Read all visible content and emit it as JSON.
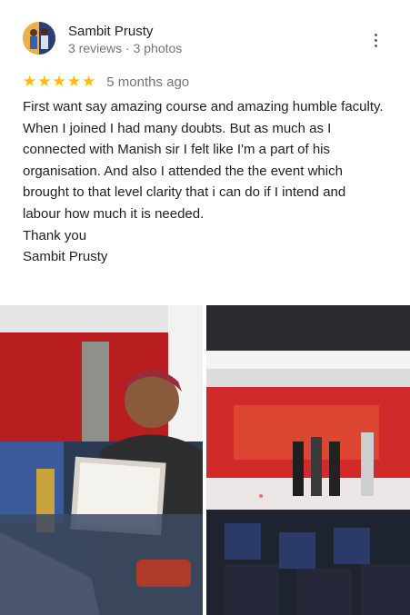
{
  "review": {
    "author": {
      "name": "Sambit Prusty",
      "meta": "3 reviews · 3 photos",
      "avatar_icon": "profile-photo"
    },
    "more_icon": "more-vert-icon",
    "rating": {
      "stars": 5,
      "max": 5,
      "star_color": "#fbbc04"
    },
    "date": "5 months ago",
    "text_lines": [
      "First want say amazing course and amazing humble faculty.",
      "When I joined I had many doubts. But as much as I connected with Manish sir I felt like I'm a part of his organisation. And also I attended the the event which brought to that level clarity that i can do if I intend and labour how much it is needed.",
      "Thank you",
      "Sambit Prusty"
    ],
    "photos": [
      {
        "description_icon": "photo-certificate"
      },
      {
        "description_icon": "photo-event-stage"
      }
    ]
  }
}
